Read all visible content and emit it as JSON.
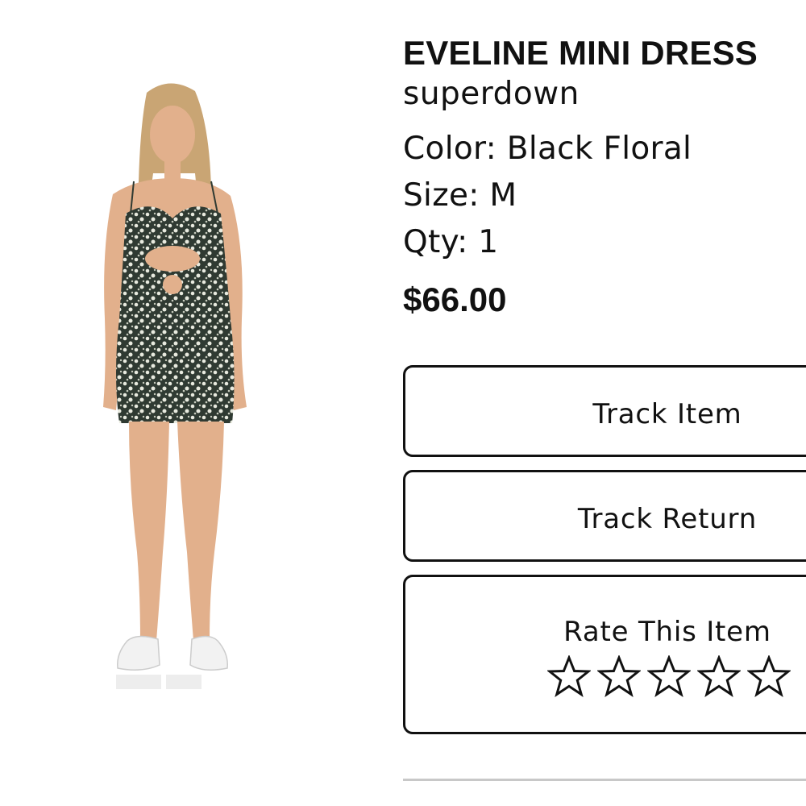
{
  "product": {
    "title": "EVELINE MINI DRESS",
    "brand": "superdown",
    "color_label": "Color: Black Floral",
    "size_label": "Size: M",
    "qty_label": "Qty: 1",
    "price": "$66.00",
    "image_icon": "product-photo"
  },
  "actions": {
    "track_item_label": "Track Item",
    "track_return_label": "Track Return",
    "rate_label": "Rate This Item",
    "rating": {
      "max": 5,
      "value": 0,
      "icon": "star-outline-icon"
    }
  },
  "colors": {
    "text": "#111111",
    "border": "#111111",
    "divider": "#c8c8c8",
    "dress_base": "#2f3a32",
    "dress_flowers": "#e8eadf",
    "skin": "#e2b08c",
    "hair": "#c9a574",
    "shoes": "#f2f2f2"
  }
}
